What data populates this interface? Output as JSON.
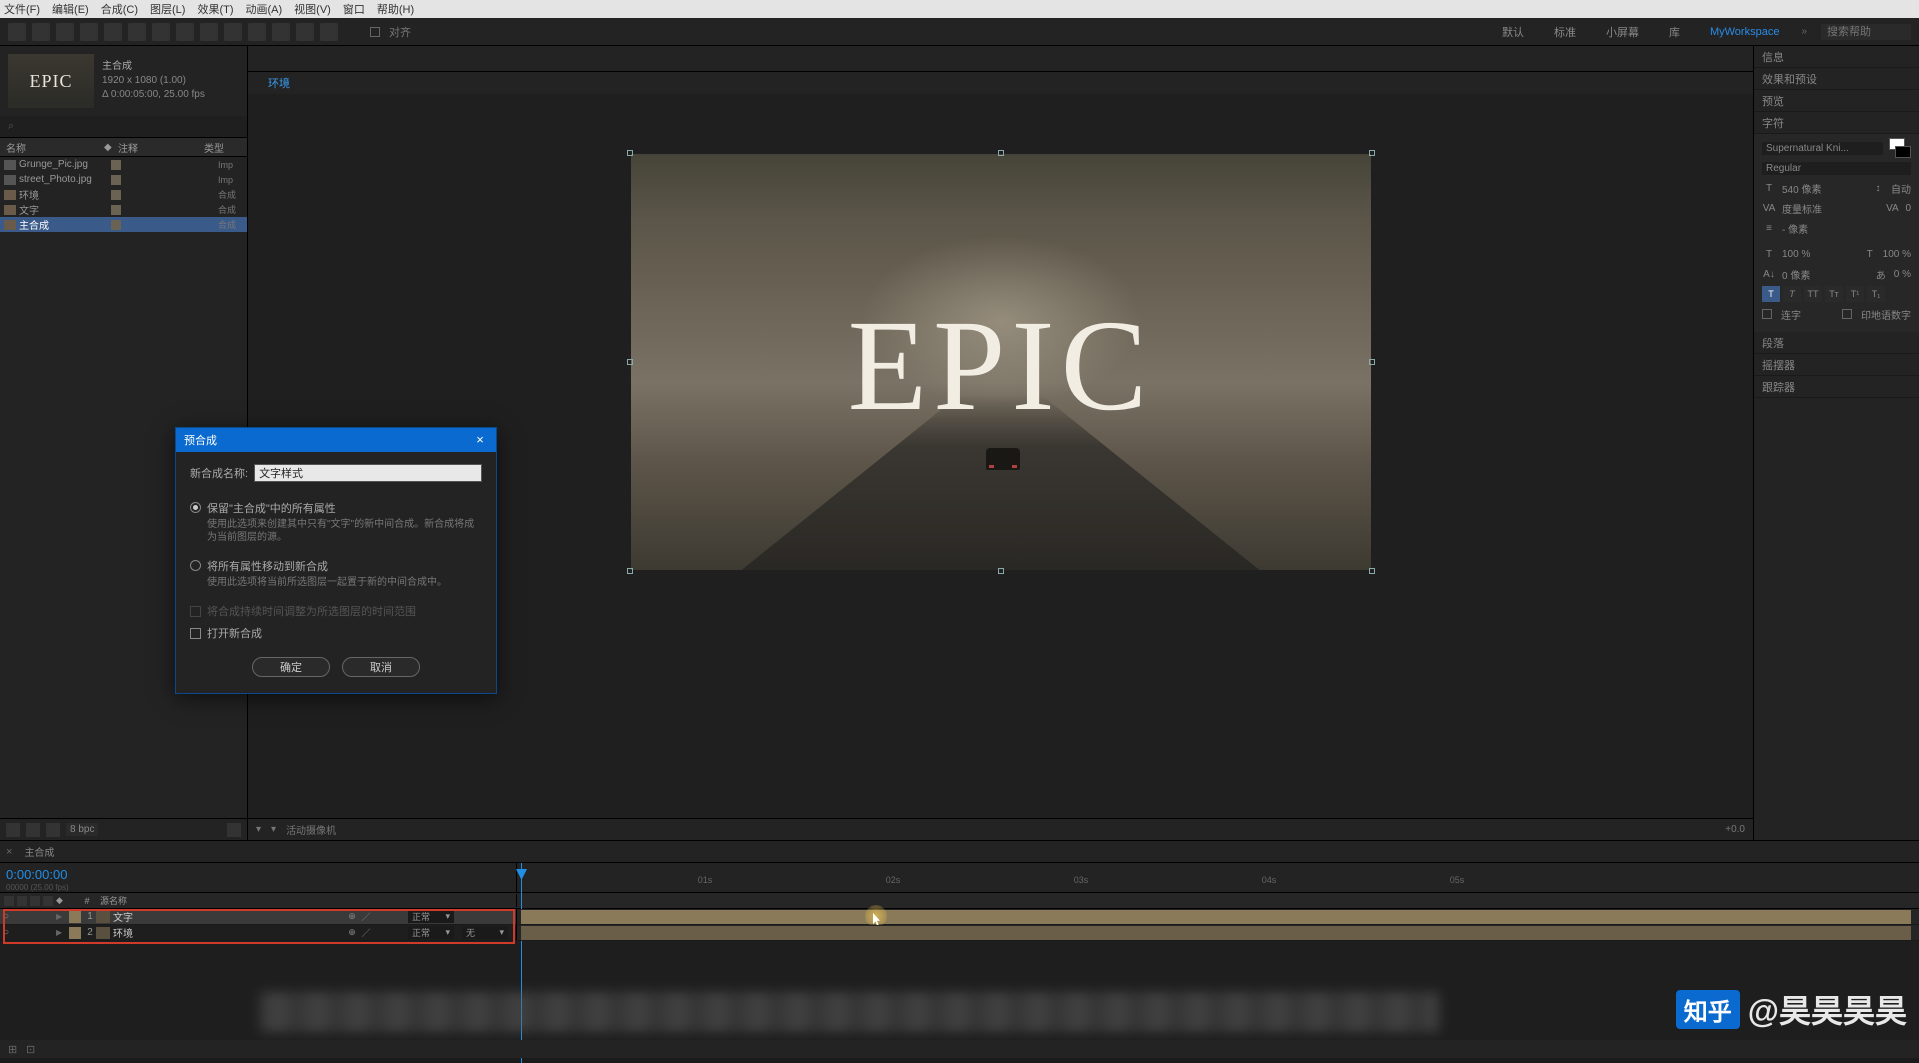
{
  "menubar": [
    "文件(F)",
    "编辑(E)",
    "合成(C)",
    "图层(L)",
    "效果(T)",
    "动画(A)",
    "视图(V)",
    "窗口",
    "帮助(H)"
  ],
  "toolbar": {
    "checkbox1_label": "对齐",
    "workspaces": [
      "默认",
      "标准",
      "小屏幕",
      "库",
      "MyWorkspace"
    ],
    "active_workspace": 4,
    "search_placeholder": "搜索帮助"
  },
  "project": {
    "comp_title": "主合成",
    "comp_dims": "1920 x 1080 (1.00)",
    "comp_dur": "Δ 0:00:05:00, 25.00 fps",
    "thumb_text": "EPIC",
    "search_icon": "⌕",
    "cols": {
      "name": "名称",
      "tag": "◆",
      "comment": "注释",
      "type": "类型"
    },
    "items": [
      {
        "kind": "img",
        "name": "Grunge_Pic.jpg",
        "type": "Imp",
        "sel": false
      },
      {
        "kind": "img",
        "name": "street_Photo.jpg",
        "type": "Imp",
        "sel": false
      },
      {
        "kind": "comp",
        "name": "环境",
        "type": "合成",
        "sel": false
      },
      {
        "kind": "comp",
        "name": "文字",
        "type": "合成",
        "sel": false
      },
      {
        "kind": "comp",
        "name": "主合成",
        "type": "合成",
        "sel": true
      }
    ],
    "bpc": "8 bpc"
  },
  "viewer": {
    "breadcrumb_active": "环境",
    "epic_text": "EPIC",
    "footer": {
      "zoom": "活动摄像机",
      "plus": "+0.0"
    }
  },
  "right": {
    "sections": [
      "信息",
      "效果和预设",
      "预览",
      "字符"
    ],
    "char": {
      "font": "Supernatural Kni...",
      "weight": "Regular",
      "size_label": "540 像素",
      "leading_label": "自动",
      "va_label": "度量标准",
      "va2_label": "0",
      "stroke_label": "- 像素",
      "scale_h": "100 %",
      "scale_v": "100 %",
      "baseline": "0 像素",
      "tsume": "0 %",
      "opt1": "连字",
      "opt2": "印地语数字"
    },
    "sections_after": [
      "段落",
      "摇摆器",
      "跟踪器"
    ]
  },
  "timeline": {
    "tab": "主合成",
    "timecode": "0:00:00:00",
    "timecode_sub": "00000 (25.00 fps)",
    "col_header": "源名称",
    "ruler": [
      "01s",
      "02s",
      "03s",
      "04s",
      "05s"
    ],
    "layers": [
      {
        "num": "1",
        "name": "文字",
        "mode": "正常",
        "track": "",
        "sel": true
      },
      {
        "num": "2",
        "name": "环境",
        "mode": "正常",
        "track": "无",
        "sel": false
      }
    ]
  },
  "dialog": {
    "title": "预合成",
    "name_label": "新合成名称:",
    "name_value": "文字样式",
    "radio1": "保留\"主合成\"中的所有属性",
    "radio1_sub": "使用此选项来创建其中只有\"文字\"的新中间合成。新合成将成为当前图层的源。",
    "radio2": "将所有属性移动到新合成",
    "radio2_sub": "使用此选项将当前所选图层一起置于新的中间合成中。",
    "check1": "将合成持续时间调整为所选图层的时间范围",
    "check2": "打开新合成",
    "ok": "确定",
    "cancel": "取消"
  },
  "watermark": {
    "logo": "知乎",
    "user": "@昊昊昊昊"
  }
}
